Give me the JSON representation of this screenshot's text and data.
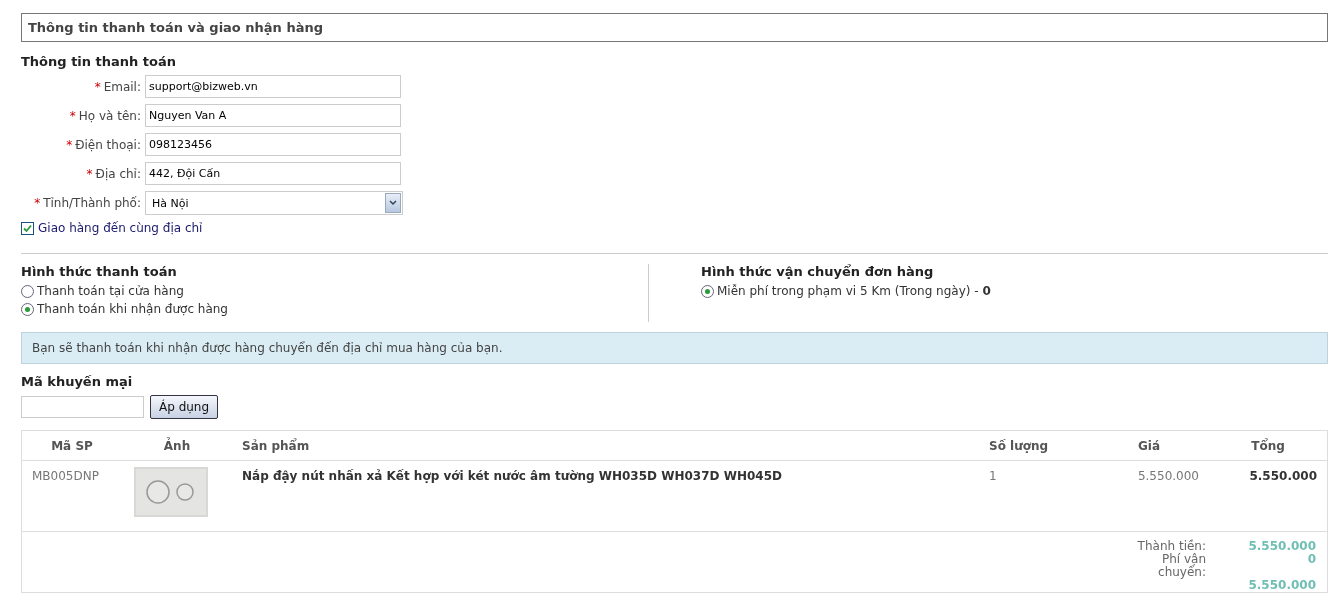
{
  "section_title": "Thông tin thanh toán và giao nhận hàng",
  "billing": {
    "title": "Thông tin thanh toán",
    "fields": [
      {
        "kind": "text",
        "label": "Email:",
        "required": true,
        "value": "support@bizweb.vn"
      },
      {
        "kind": "text",
        "label": "Họ và tên:",
        "required": true,
        "value": "Nguyen Van A"
      },
      {
        "kind": "text",
        "label": "Điện thoại:",
        "required": true,
        "value": "098123456"
      },
      {
        "kind": "text",
        "label": "Địa chỉ:",
        "required": true,
        "value": "442, Đội Cấn"
      },
      {
        "kind": "select",
        "label": "Tỉnh/Thành phố:",
        "required": true,
        "value": "Hà Nội"
      }
    ],
    "required_mark": "*",
    "same_address": {
      "label": "Giao hàng đến cùng địa chỉ",
      "checked": true
    }
  },
  "payment": {
    "title": "Hình thức thanh toán",
    "options": [
      {
        "label": "Thanh toán tại cửa hàng",
        "selected": false
      },
      {
        "label": "Thanh toán khi nhận được hàng",
        "selected": true
      }
    ]
  },
  "shipping": {
    "title": "Hình thức vận chuyển đơn hàng",
    "options": [
      {
        "label": "Miễn phí trong phạm vi 5 Km (Trong ngày) - **0**",
        "selected": true
      }
    ]
  },
  "notice": "Bạn sẽ thanh toán khi nhận được hàng chuyển đến địa chỉ mua hàng của bạn.",
  "promo": {
    "title": "Mã khuyến mại",
    "button": "Áp dụng"
  },
  "table": {
    "columns": [
      "Mã SP",
      "Ảnh",
      "Sản phẩm",
      "Số lượng",
      "Giá",
      "Tổng"
    ],
    "rows": [
      {
        "sku": "MB005DNP",
        "product": "Nắp đậy nút nhấn xả Kết hợp với két nước âm tường WH035D WH037D WH045D",
        "quantity": "1",
        "price": "5.550.000",
        "total": "5.550.000"
      }
    ],
    "summary": [
      {
        "label": "Thành tiền:",
        "value": "5.550.000"
      },
      {
        "label": "Phí vận chuyển:",
        "value": "0"
      },
      {
        "value": "5.550.000"
      }
    ]
  }
}
